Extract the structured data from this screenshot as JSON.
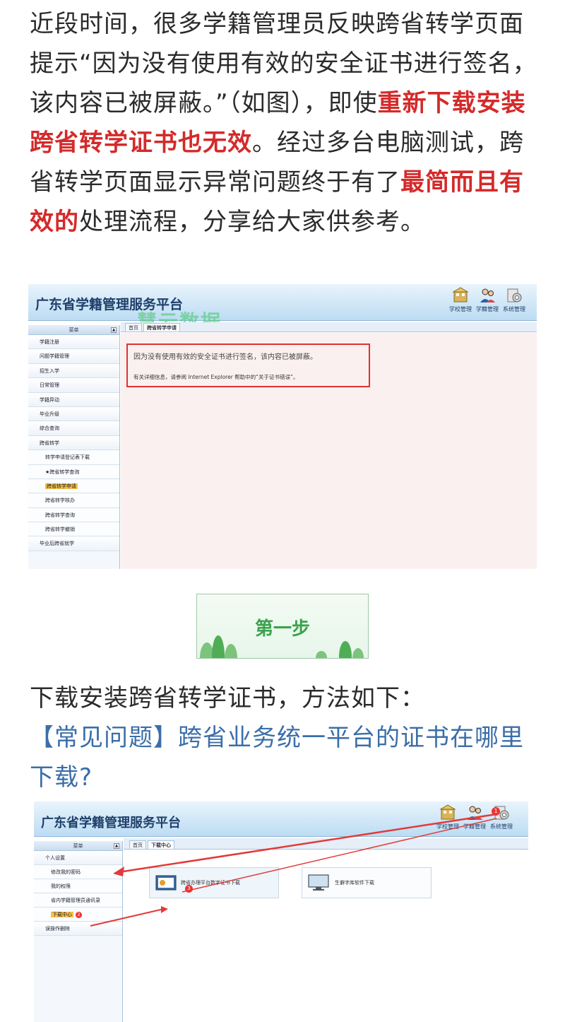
{
  "intro": {
    "t1": "近段时间，很多学籍管理员反映跨省转学页面提示“因为没有使用有效的安全证书进行签名，该内容已被屏蔽。”（如图），即使",
    "t2": "重新下载安装跨省转学证书也无效",
    "t3": "。经过多台电脑测试，跨省转学页面显示异常问题终于有了",
    "t4": "最简而且有效的",
    "t5": "处理流程，分享给大家供参考。"
  },
  "shot1": {
    "title": "广东省学籍管理服务平台",
    "watermark": "慧云数据",
    "nav": [
      "学校管理",
      "学籍管理",
      "系统管理"
    ],
    "menu_head": "菜单",
    "tabs": [
      "首页",
      "跨省转学申请"
    ],
    "menu": [
      {
        "label": "学籍注册",
        "sub": false
      },
      {
        "label": "问题学籍管理",
        "sub": false
      },
      {
        "label": "招生入学",
        "sub": false
      },
      {
        "label": "日常管理",
        "sub": false
      },
      {
        "label": "学籍异动",
        "sub": false
      },
      {
        "label": "毕业升级",
        "sub": false
      },
      {
        "label": "综合查询",
        "sub": false
      },
      {
        "label": "跨省转学",
        "sub": false
      },
      {
        "label": "转学申请登记表下载",
        "sub": true
      },
      {
        "label": "★跨省转学查询",
        "sub": true
      },
      {
        "label": "跨省转学申请",
        "sub": true,
        "active": true
      },
      {
        "label": "跨省转学核办",
        "sub": true
      },
      {
        "label": "跨省转学查询",
        "sub": true
      },
      {
        "label": "跨省转学撤销",
        "sub": true
      },
      {
        "label": "毕业后跨省就学",
        "sub": false
      }
    ],
    "error_main": "因为没有使用有效的安全证书进行签名，该内容已被屏蔽。",
    "error_detail": "有关详细信息，请参阅 Internet Explorer 帮助中的“关于证书错误”。"
  },
  "step": {
    "label": "第一步"
  },
  "section": {
    "heading": "下载安装跨省转学证书，方法如下：",
    "link": "【常见问题】跨省业务统一平台的证书在哪里下载?"
  },
  "shot2": {
    "title": "广东省学籍管理服务平台",
    "nav": [
      "学校管理",
      "学籍管理",
      "系统管理"
    ],
    "menu_head": "菜单",
    "tabs": [
      "首页",
      "下载中心"
    ],
    "menu": [
      {
        "label": "个人设置",
        "sub": false
      },
      {
        "label": "修改我的密码",
        "sub": true
      },
      {
        "label": "我的权限",
        "sub": true
      },
      {
        "label": "省内学籍管理员通讯录",
        "sub": true
      },
      {
        "label": "下载中心",
        "sub": true,
        "active": true
      },
      {
        "label": "误操作删除",
        "sub": false
      }
    ],
    "badges": [
      "1",
      "2",
      "3"
    ],
    "cards": [
      {
        "label": "跨省办理平台数字证书下载"
      },
      {
        "label": "生僻字库软件下载"
      }
    ]
  },
  "colors": {
    "accent_red": "#d42a2a",
    "link_blue": "#3b6ea8",
    "step_green": "#3ba34e"
  }
}
